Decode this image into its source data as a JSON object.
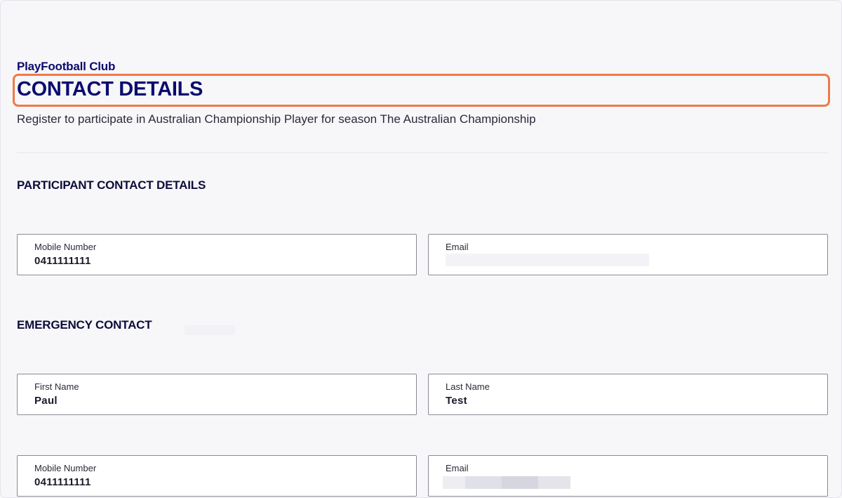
{
  "header": {
    "club_name": "PlayFootball Club",
    "page_title": "CONTACT DETAILS",
    "subtitle": "Register to participate in Australian Championship Player for season The Australian Championship"
  },
  "participant_section": {
    "heading": "PARTICIPANT CONTACT DETAILS",
    "mobile": {
      "label": "Mobile Number",
      "value": "0411111111"
    },
    "email": {
      "label": "Email",
      "value": ""
    }
  },
  "emergency_section": {
    "heading": "EMERGENCY CONTACT",
    "first_name": {
      "label": "First Name",
      "value": "Paul"
    },
    "last_name": {
      "label": "Last Name",
      "value": "Test"
    },
    "mobile": {
      "label": "Mobile Number",
      "value": "0411111111"
    },
    "email": {
      "label": "Email",
      "value": ""
    }
  },
  "colors": {
    "brand_navy": "#0b0b6e",
    "highlight_orange": "#f07a45",
    "background": "#f7f7fa"
  }
}
